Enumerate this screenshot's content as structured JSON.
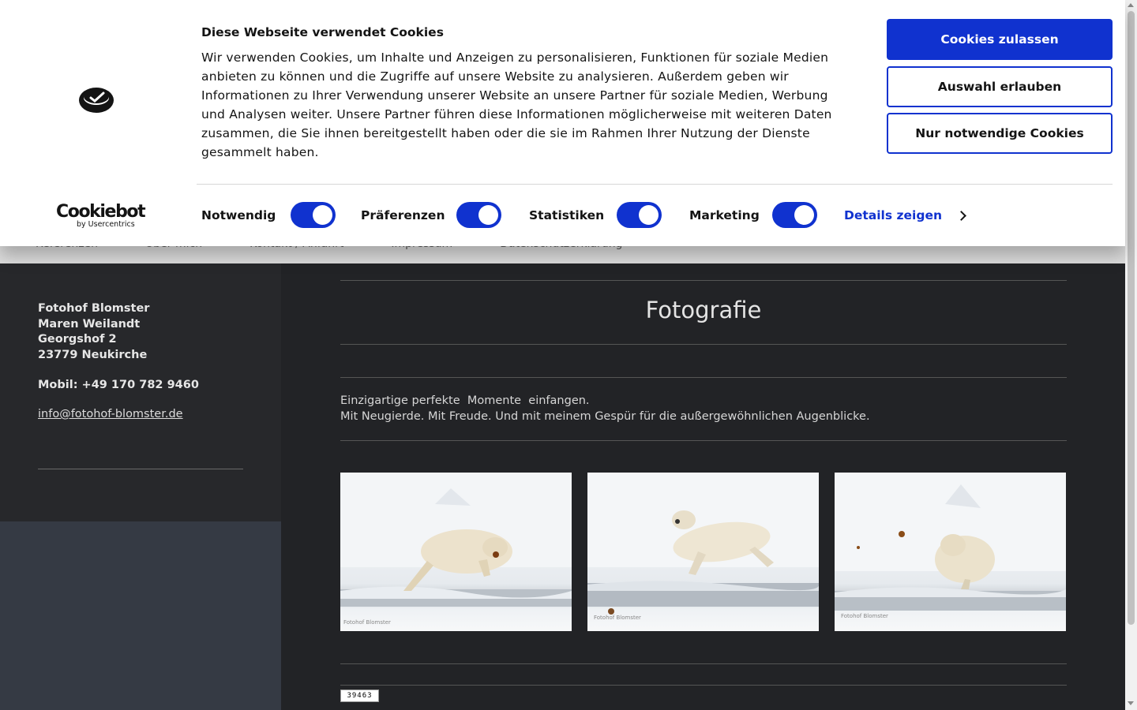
{
  "nav": {
    "items": [
      "Referenzen",
      "Über mich",
      "Kontakt / Anfahrt",
      "Impressum",
      "Datenschutzerklärung"
    ]
  },
  "sidebar": {
    "address_lines": [
      "Fotohof Blomster",
      "Maren Weilandt",
      "Georgshof 2",
      "23779 Neukirche"
    ],
    "mobile": "Mobil: +49 170 782 9460",
    "email": "info@fotohof-blomster.de"
  },
  "main": {
    "title": "Fotografie",
    "intro_line1": "Einzigartige perfekte  Momente  einfangen.",
    "intro_line2": "Mit Neugierde. Mit Freude. Und mit meinem Gespür für die außergewöhnlichen Augenblicke.",
    "photos": [
      {
        "subject": "polar bear on ice",
        "watermark": "Fotohof Blomster"
      },
      {
        "subject": "polar bear leaping",
        "watermark": "Fotohof Blomster"
      },
      {
        "subject": "polar bear shaking off water",
        "watermark": "Fotohof Blomster"
      }
    ],
    "counter": "39463"
  },
  "cookie_banner": {
    "title": "Diese Webseite verwendet Cookies",
    "text": "Wir verwenden Cookies, um Inhalte und Anzeigen zu personalisieren, Funktionen für soziale Medien anbieten zu können und die Zugriffe auf unsere Website zu analysieren. Außerdem geben wir Informationen zu Ihrer Verwendung unserer Website an unsere Partner für soziale Medien, Werbung und Analysen weiter. Unsere Partner führen diese Informationen möglicherweise mit weiteren Daten zusammen, die Sie ihnen bereitgestellt haben oder die sie im Rahmen Ihrer Nutzung der Dienste gesammelt haben.",
    "buttons": {
      "allow_all": "Cookies zulassen",
      "allow_selection": "Auswahl erlauben",
      "necessary_only": "Nur notwendige Cookies"
    },
    "brand": {
      "name": "Cookiebot",
      "sub": "by Usercentrics"
    },
    "toggles": [
      {
        "label": "Notwendig",
        "on": true
      },
      {
        "label": "Präferenzen",
        "on": true
      },
      {
        "label": "Statistiken",
        "on": true
      },
      {
        "label": "Marketing",
        "on": true
      }
    ],
    "details_label": "Details zeigen"
  },
  "colors": {
    "accent": "#1032cf",
    "page_background": "#222326",
    "sidebar_lower": "#353a44"
  }
}
